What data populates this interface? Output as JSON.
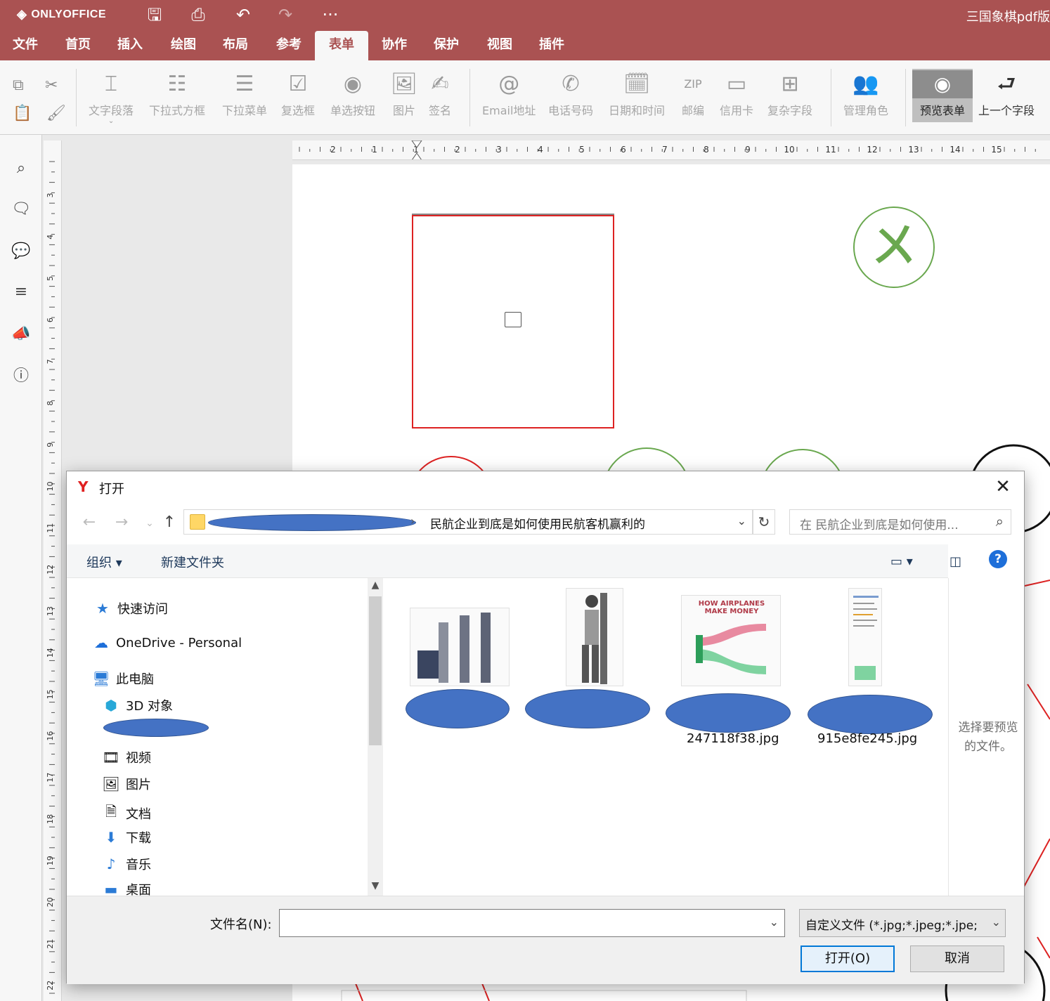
{
  "app": {
    "brand": "ONLYOFFICE",
    "doc_title": "三国象棋pdf版",
    "accent": "#aa5252"
  },
  "quick_access": {
    "save_icon": "save-icon",
    "print_icon": "print-icon",
    "undo_icon": "undo-icon",
    "redo_icon": "redo-icon",
    "more": "···"
  },
  "tabs": [
    {
      "label": "文件"
    },
    {
      "label": "首页"
    },
    {
      "label": "插入"
    },
    {
      "label": "绘图"
    },
    {
      "label": "布局"
    },
    {
      "label": "参考"
    },
    {
      "label": "表单",
      "active": true
    },
    {
      "label": "协作"
    },
    {
      "label": "保护"
    },
    {
      "label": "视图"
    },
    {
      "label": "插件"
    }
  ],
  "ribbon": {
    "text_field": "文字段落",
    "combo_box": "下拉式方框",
    "dropdown": "下拉菜单",
    "checkbox": "复选框",
    "radio": "单选按钮",
    "image": "图片",
    "signature": "签名",
    "email": "Email地址",
    "phone": "电话号码",
    "datetime": "日期和时间",
    "zip": "邮编",
    "credit_card": "信用卡",
    "complex": "复杂字段",
    "roles": "管理角色",
    "preview": "预览表单",
    "prev_field": "上一个字段",
    "zip_glyph": "ZIP"
  },
  "ruler": {
    "h_labels": [
      "2",
      "1",
      "1",
      "2",
      "3",
      "4",
      "5",
      "6",
      "7",
      "8",
      "9",
      "10",
      "11",
      "12",
      "13",
      "14",
      "15"
    ],
    "v_labels": [
      "3",
      "4",
      "5",
      "6",
      "7",
      "8",
      "9",
      "10",
      "11",
      "12",
      "13",
      "14",
      "15",
      "16",
      "17",
      "18",
      "19",
      "20",
      "21",
      "22"
    ],
    "corner": "L"
  },
  "dialog": {
    "title": "打开",
    "close": "✕",
    "path": "民航企业到底是如何使用民航客机赢利的",
    "search_placeholder": "在 民航企业到底是如何使用...",
    "organize": "组织 ▾",
    "new_folder": "新建文件夹",
    "nav": {
      "quick_access": "快速访问",
      "onedrive": "OneDrive - Personal",
      "this_pc": "此电脑",
      "objects3d": "3D 对象",
      "videos": "视频",
      "pictures": "图片",
      "documents": "文档",
      "downloads": "下载",
      "music": "音乐",
      "desktop": "桌面"
    },
    "files": [
      {
        "name": ""
      },
      {
        "name": ""
      },
      {
        "name": "247118f38.jpg"
      },
      {
        "name": "915e8fe245.jpg"
      }
    ],
    "thumb3_text": "HOW AIRPLANES MAKE MONEY",
    "preview_msg": "选择要预览的文件。",
    "filename_label": "文件名(N):",
    "filename_value": "",
    "filter": "自定义文件 (*.jpg;*.jpeg;*.jpe;",
    "open": "打开(O)",
    "cancel": "取消"
  }
}
